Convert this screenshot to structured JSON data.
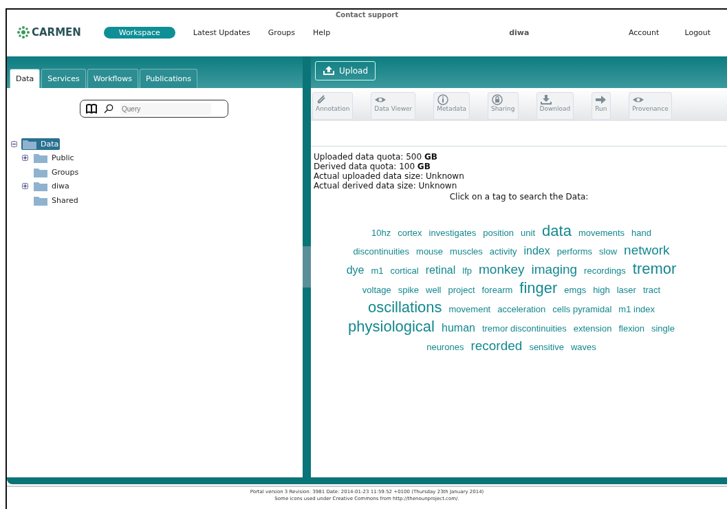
{
  "header": {
    "contact": "Contact support",
    "logo": "CARMEN",
    "nav": [
      {
        "label": "Workspace",
        "selected": true
      },
      {
        "label": "Latest Updates",
        "selected": false
      },
      {
        "label": "Groups",
        "selected": false
      },
      {
        "label": "Help",
        "selected": false
      }
    ],
    "user": "diwa",
    "account": "Account",
    "logout": "Logout"
  },
  "tabs": [
    {
      "label": "Data",
      "selected": true
    },
    {
      "label": "Services",
      "selected": false
    },
    {
      "label": "Workflows",
      "selected": false
    },
    {
      "label": "Publications",
      "selected": false
    }
  ],
  "search": {
    "placeholder": "Query"
  },
  "tree": [
    {
      "label": "Data",
      "selected": true,
      "expandable": true,
      "expanded": true,
      "children": [
        {
          "label": "Public",
          "selected": false,
          "expandable": true,
          "expanded": false
        },
        {
          "label": "Groups",
          "selected": false,
          "expandable": false
        },
        {
          "label": "diwa",
          "selected": false,
          "expandable": true,
          "expanded": false
        },
        {
          "label": "Shared",
          "selected": false,
          "expandable": false
        }
      ]
    }
  ],
  "upload": "Upload",
  "toolbar": [
    {
      "label": "Annotation",
      "kind": "clip",
      "disabled": true
    },
    {
      "label": "Data Viewer",
      "kind": "eye",
      "disabled": true
    },
    {
      "label": "Metadata",
      "kind": "info",
      "disabled": true
    },
    {
      "label": "Sharing",
      "kind": "lock",
      "disabled": true
    },
    {
      "label": "Download",
      "kind": "download",
      "disabled": true
    },
    {
      "label": "Run",
      "kind": "arrow",
      "disabled": true
    },
    {
      "label": "Provenance",
      "kind": "eye",
      "disabled": true
    }
  ],
  "quota": [
    "Uploaded data quota: 500 **GB**",
    "Derived data quota: 100 **GB**",
    "Actual uploaded data size: Unknown",
    "Actual derived data size: Unknown"
  ],
  "tag_prompt": "Click on a tag to search the Data:",
  "tags": [
    {
      "label": "10hz",
      "kind": "small"
    },
    {
      "label": "cortex",
      "kind": "small"
    },
    {
      "label": "investigates",
      "kind": "small"
    },
    {
      "label": "position",
      "kind": "small"
    },
    {
      "label": "unit",
      "kind": "small"
    },
    {
      "label": "data",
      "kind": "xlarge"
    },
    {
      "label": "movements",
      "kind": "small"
    },
    {
      "label": "hand",
      "kind": "small"
    },
    {
      "label": "discontinuities",
      "kind": "small"
    },
    {
      "label": "mouse",
      "kind": "small"
    },
    {
      "label": "muscles",
      "kind": "small"
    },
    {
      "label": "activity",
      "kind": "small"
    },
    {
      "label": "index",
      "kind": "medium"
    },
    {
      "label": "performs",
      "kind": "small"
    },
    {
      "label": "slow",
      "kind": "small"
    },
    {
      "label": "network",
      "kind": "large"
    },
    {
      "label": "dye",
      "kind": "medium"
    },
    {
      "label": "m1",
      "kind": "small"
    },
    {
      "label": "cortical",
      "kind": "small"
    },
    {
      "label": "retinal",
      "kind": "medium"
    },
    {
      "label": "lfp",
      "kind": "small"
    },
    {
      "label": "monkey",
      "kind": "large"
    },
    {
      "label": "imaging",
      "kind": "large"
    },
    {
      "label": "recordings",
      "kind": "small"
    },
    {
      "label": "tremor",
      "kind": "xlarge"
    },
    {
      "label": "voltage",
      "kind": "small"
    },
    {
      "label": "spike",
      "kind": "small"
    },
    {
      "label": "well",
      "kind": "small"
    },
    {
      "label": "project",
      "kind": "small"
    },
    {
      "label": "forearm",
      "kind": "small"
    },
    {
      "label": "finger",
      "kind": "xlarge"
    },
    {
      "label": "emgs",
      "kind": "small"
    },
    {
      "label": "high",
      "kind": "small"
    },
    {
      "label": "laser",
      "kind": "small"
    },
    {
      "label": "tract",
      "kind": "small"
    },
    {
      "label": "oscillations",
      "kind": "xlarge"
    },
    {
      "label": "movement",
      "kind": "small"
    },
    {
      "label": "acceleration",
      "kind": "small"
    },
    {
      "label": "cells pyramidal",
      "kind": "small"
    },
    {
      "label": "m1 index",
      "kind": "small"
    },
    {
      "label": "physiological",
      "kind": "xlarge"
    },
    {
      "label": "human",
      "kind": "medium"
    },
    {
      "label": "tremor discontinuities",
      "kind": "small"
    },
    {
      "label": "extension",
      "kind": "small"
    },
    {
      "label": "flexion",
      "kind": "small"
    },
    {
      "label": "single",
      "kind": "small"
    },
    {
      "label": "neurones",
      "kind": "small"
    },
    {
      "label": "recorded",
      "kind": "large"
    },
    {
      "label": "sensitive",
      "kind": "small"
    },
    {
      "label": "waves",
      "kind": "small"
    }
  ],
  "footer": [
    "Portal version 3 Revision: 3981 Date: 2014-01-23 11:59:52 +0100 (Thursday 23th January 2014)",
    "Some icons used under Creative Commons from http://thenounproject.com/."
  ]
}
